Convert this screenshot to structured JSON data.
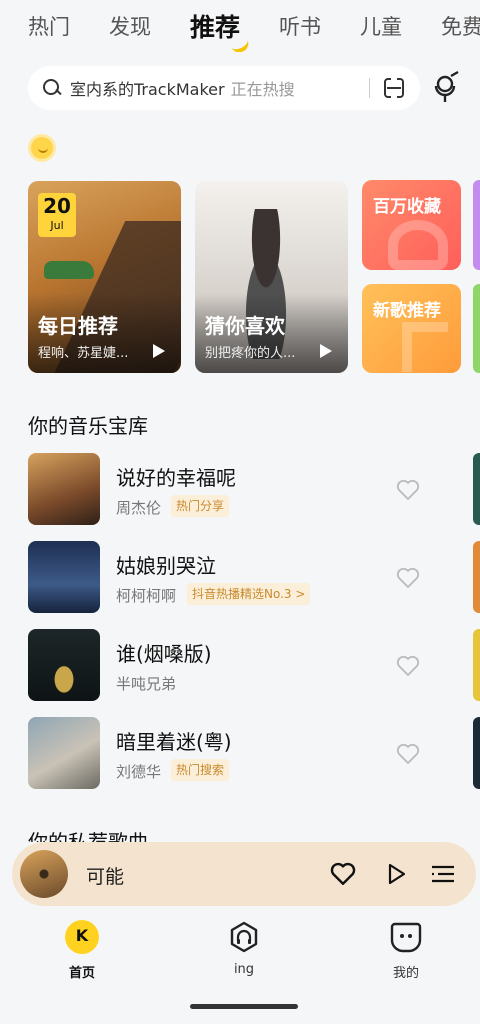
{
  "top_tabs": [
    {
      "label": "热门"
    },
    {
      "label": "发现"
    },
    {
      "label": "推荐"
    },
    {
      "label": "听书"
    },
    {
      "label": "儿童"
    },
    {
      "label": "免费"
    }
  ],
  "active_tab": "推荐",
  "search": {
    "query": "室内系的TrackMaker",
    "hint": "正在热搜"
  },
  "cards": {
    "daily": {
      "date_day": "20",
      "date_month": "Jul",
      "title": "每日推荐",
      "subtitle": "程响、苏星婕..."
    },
    "guess": {
      "title": "猜你喜欢",
      "subtitle": "别把疼你的人..."
    },
    "million": {
      "title": "百万收藏"
    },
    "new_songs": {
      "title": "新歌推荐"
    }
  },
  "library": {
    "title": "你的音乐宝库",
    "songs": [
      {
        "title": "说好的幸福呢",
        "artist": "周杰伦",
        "tag": "热门分享"
      },
      {
        "title": "姑娘别哭泣",
        "artist": "柯柯柯啊",
        "tag": "抖音热播精选No.3 >"
      },
      {
        "title": "谁(烟嗓版)",
        "artist": "半吨兄弟",
        "tag": ""
      },
      {
        "title": "暗里着迷(粤)",
        "artist": "刘德华",
        "tag": "热门搜索"
      }
    ]
  },
  "next_section_title": "你的私荐歌曲",
  "player": {
    "title": "可能"
  },
  "bottom_nav": [
    {
      "label": "首页"
    },
    {
      "label": "ing"
    },
    {
      "label": "我的"
    }
  ],
  "colors": {
    "accent": "#ffd21f",
    "tag_bg": "#fbefd9",
    "tag_text": "#c98a2e",
    "player_bg": "#f4e3ce"
  }
}
